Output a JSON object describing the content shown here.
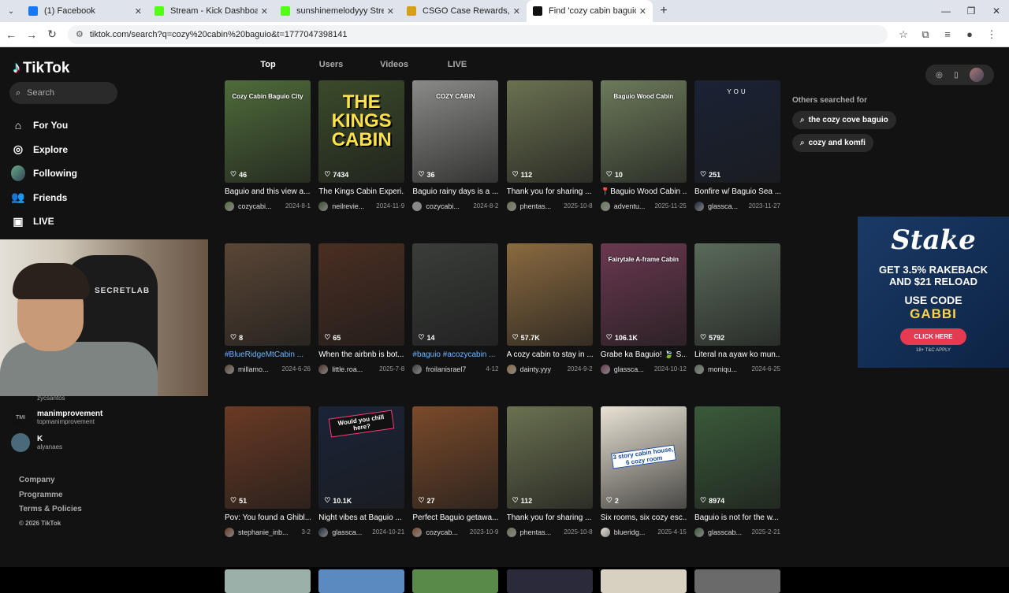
{
  "browser": {
    "tabs": [
      {
        "title": "(1) Facebook",
        "color": "#1877f2",
        "active": false
      },
      {
        "title": "Stream - Kick Dashboard",
        "color": "#53fc18",
        "active": false
      },
      {
        "title": "sunshinemelodyyy Stream - W…",
        "color": "#53fc18",
        "active": false
      },
      {
        "title": "CSGO Case Rewards, CSGO Sk…",
        "color": "#d4a017",
        "active": false
      },
      {
        "title": "Find 'cozy cabin baguio' on Tik…",
        "color": "#111111",
        "active": true
      }
    ],
    "url": "tiktok.com/search?q=cozy%20cabin%20baguio&t=1777047398141"
  },
  "tiktok": {
    "logo": "TikTok",
    "search_placeholder": "Search",
    "nav": [
      {
        "label": "For You",
        "icon": "home-icon"
      },
      {
        "label": "Explore",
        "icon": "compass-icon"
      },
      {
        "label": "Following",
        "icon": "avatar-icon"
      },
      {
        "label": "Friends",
        "icon": "friends-icon"
      },
      {
        "label": "LIVE",
        "icon": "live-icon"
      }
    ],
    "following": [
      {
        "name": "",
        "user": "zycsantos"
      },
      {
        "name": "manimprovement",
        "user": "topmanimprovement"
      },
      {
        "name": "K",
        "user": "alyanaes"
      }
    ],
    "footer": {
      "company": "Company",
      "programme": "Programme",
      "terms": "Terms & Policies",
      "copyright": "© 2026 TikTok"
    },
    "tabs": [
      "Top",
      "Users",
      "Videos",
      "LIVE"
    ],
    "others_title": "Others searched for",
    "others": [
      "the cozy cove baguio",
      "cozy and komfi"
    ],
    "videos": [
      {
        "likes": "46",
        "caption": "Baguio and this view a...",
        "user": "cozycabi...",
        "date": "2024-8-1",
        "overlay": "Cozy Cabin Baguio City",
        "bg": "#4f6b3a",
        "blue": false
      },
      {
        "likes": "7434",
        "caption": "The Kings Cabin Experi...",
        "user": "neilrevie...",
        "date": "2024-11-9",
        "overlay": "THE KINGS CABIN",
        "bg": "#3a4a2a",
        "blue": false
      },
      {
        "likes": "36",
        "caption": "Baguio rainy days is a ...",
        "user": "cozycabi...",
        "date": "2024-8-2",
        "overlay": "COZY CABIN",
        "bg": "#8a8a88",
        "blue": false
      },
      {
        "likes": "112",
        "caption": "Thank you for sharing ...",
        "user": "phentas...",
        "date": "2025-10-8",
        "overlay": "",
        "bg": "#6a7150",
        "blue": false
      },
      {
        "likes": "10",
        "caption": "📍Baguio Wood Cabin ...",
        "user": "adventu...",
        "date": "2025-11-25",
        "overlay": "Baguio Wood Cabin",
        "bg": "#6c7a5a",
        "blue": false
      },
      {
        "likes": "251",
        "caption": "Bonfire w/ Baguio Sea ...",
        "user": "glassca...",
        "date": "2023-11-27",
        "overlay": "YOU",
        "bg": "#1a2235",
        "blue": false
      },
      {
        "likes": "8",
        "caption": "#BlueRidgeMtCabin ...",
        "user": "millamo...",
        "date": "2024-6-26",
        "overlay": "",
        "bg": "#5a4636",
        "blue": true
      },
      {
        "likes": "65",
        "caption": "When the airbnb is bot...",
        "user": "little.roa...",
        "date": "2025-7-8",
        "overlay": "",
        "bg": "#4a2e22",
        "blue": false
      },
      {
        "likes": "14",
        "caption": "#baguio #acozycabin ...",
        "user": "froilanisrael7",
        "date": "4-12",
        "overlay": "",
        "bg": "#3a3d3a",
        "blue": true
      },
      {
        "likes": "57.7K",
        "caption": "A cozy cabin to stay in ...",
        "user": "dainty.yyy",
        "date": "2024-9-2",
        "overlay": "",
        "bg": "#8a6a40",
        "blue": false
      },
      {
        "likes": "106.1K",
        "caption": "Grabe ka Baguio! 🍃 S...",
        "user": "glassca...",
        "date": "2024-10-12",
        "overlay": "Fairytale A-frame Cabin",
        "bg": "#6a3850",
        "blue": false
      },
      {
        "likes": "5792",
        "caption": "Literal na ayaw ko mun...",
        "user": "moniqu...",
        "date": "2024-6-25",
        "overlay": "",
        "bg": "#5a6a5a",
        "blue": false
      },
      {
        "likes": "51",
        "caption": "Pov: You found a Ghibl...",
        "user": "stephanie_inb...",
        "date": "3-2",
        "overlay": "",
        "bg": "#6a3a24",
        "blue": false
      },
      {
        "likes": "10.1K",
        "caption": "Night vibes at Baguio ...",
        "user": "glassca...",
        "date": "2024-10-21",
        "overlay": "Would you chill here?",
        "bg": "#1a2438",
        "blue": false
      },
      {
        "likes": "27",
        "caption": "Perfect Baguio getawa...",
        "user": "cozycab...",
        "date": "2023-10-9",
        "overlay": "",
        "bg": "#7a4a2a",
        "blue": false
      },
      {
        "likes": "112",
        "caption": "Thank you for sharing ...",
        "user": "phentas...",
        "date": "2025-10-8",
        "overlay": "",
        "bg": "#6a7150",
        "blue": false
      },
      {
        "likes": "2",
        "caption": "Six rooms, six cozy esc...",
        "user": "blueridg...",
        "date": "2025-4-15",
        "overlay": "3 story cabin house, 6 cozy room",
        "bg": "#e8e2d4",
        "blue": false
      },
      {
        "likes": "8974",
        "caption": "Baguio is not for the w...",
        "user": "glasscab...",
        "date": "2025-2-21",
        "overlay": "",
        "bg": "#3a5a3a",
        "blue": false
      }
    ],
    "next_row_colors": [
      "#9ab0a8",
      "#5a8abf",
      "#5a8a4a",
      "#2a2a3a",
      "#d8d0c0",
      "#6a6a6a"
    ]
  },
  "ad": {
    "brand": "Stake",
    "line1": "GET 3.5% RAKEBACK",
    "line2": "AND $21 RELOAD",
    "line3": "USE CODE",
    "code": "GABBI",
    "button": "CLICK HERE",
    "fine": "18+ T&C APPLY"
  },
  "webcam": {
    "label": "SECRETLAB"
  }
}
